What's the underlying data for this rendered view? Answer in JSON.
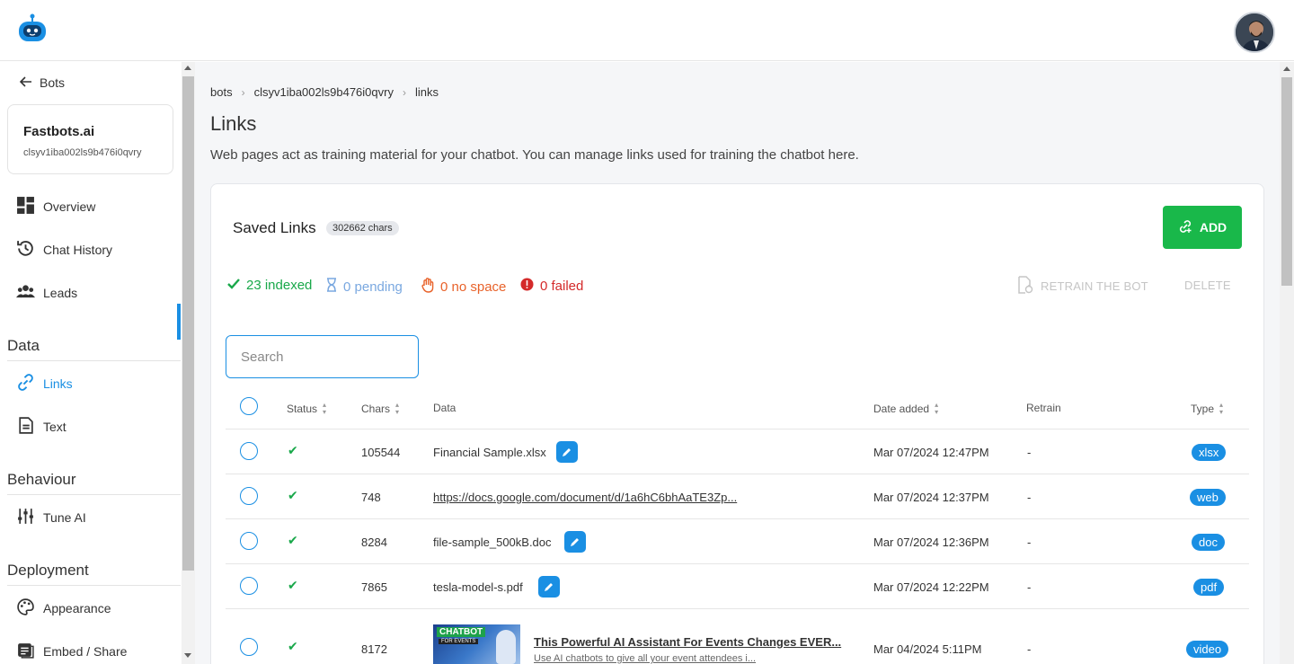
{
  "header": {
    "logo_icon": "robot-logo-icon",
    "avatar_icon": "user-avatar-icon"
  },
  "sidebar": {
    "back_label": "Bots",
    "bot": {
      "name": "Fastbots.ai",
      "id": "clsyv1iba002ls9b476i0qvry"
    },
    "items": [
      {
        "label": "Overview",
        "icon": "dashboard-icon"
      },
      {
        "label": "Chat History",
        "icon": "history-icon"
      },
      {
        "label": "Leads",
        "icon": "users-icon"
      }
    ],
    "sections": {
      "data": {
        "title": "Data",
        "items": [
          {
            "label": "Links",
            "icon": "link-icon",
            "active": true
          },
          {
            "label": "Text",
            "icon": "text-doc-icon"
          }
        ]
      },
      "behaviour": {
        "title": "Behaviour",
        "items": [
          {
            "label": "Tune AI",
            "icon": "sliders-icon"
          }
        ]
      },
      "deployment": {
        "title": "Deployment",
        "items": [
          {
            "label": "Appearance",
            "icon": "palette-icon"
          },
          {
            "label": "Embed / Share",
            "icon": "embed-icon"
          }
        ]
      }
    }
  },
  "breadcrumb": [
    "bots",
    "clsyv1iba002ls9b476i0qvry",
    "links"
  ],
  "page": {
    "title": "Links",
    "description": "Web pages act as training material for your chatbot. You can manage links used for training the chatbot here."
  },
  "card": {
    "title": "Saved Links",
    "chars_badge": "302662 chars",
    "add_label": "ADD",
    "stats": {
      "indexed": "23 indexed",
      "pending": "0 pending",
      "no_space": "0 no space",
      "failed": "0 failed"
    },
    "retrain_label": "RETRAIN THE BOT",
    "delete_label": "DELETE",
    "search_placeholder": "Search"
  },
  "table": {
    "columns": {
      "status": "Status",
      "chars": "Chars",
      "data": "Data",
      "date": "Date added",
      "retrain": "Retrain",
      "type": "Type"
    },
    "rows": [
      {
        "chars": "105544",
        "data": "Financial Sample.xlsx",
        "date": "Mar 07/2024 12:47PM",
        "retrain": "-",
        "type": "xlsx"
      },
      {
        "chars": "748",
        "data": "https://docs.google.com/document/d/1a6hC6bhAaTE3Zp...",
        "date": "Mar 07/2024 12:37PM",
        "retrain": "-",
        "type": "web"
      },
      {
        "chars": "8284",
        "data": "file-sample_500kB.doc",
        "date": "Mar 07/2024 12:36PM",
        "retrain": "-",
        "type": "doc"
      },
      {
        "chars": "7865",
        "data": "tesla-model-s.pdf",
        "date": "Mar 07/2024 12:22PM",
        "retrain": "-",
        "type": "pdf"
      },
      {
        "chars": "8172",
        "data": "This Powerful AI Assistant For Events Changes EVER...",
        "subtitle": "Use AI chatbots to give all your event attendees i...",
        "thumb_title": "CHATBOT",
        "thumb_sub": "FOR EVENTS",
        "date": "Mar 04/2024 5:11PM",
        "retrain": "-",
        "type": "video"
      }
    ]
  },
  "colors": {
    "accent": "#1a8fe3",
    "success": "#19b84a",
    "pending": "#7aa8e0",
    "warning": "#e8622a",
    "error": "#d42a2a"
  }
}
